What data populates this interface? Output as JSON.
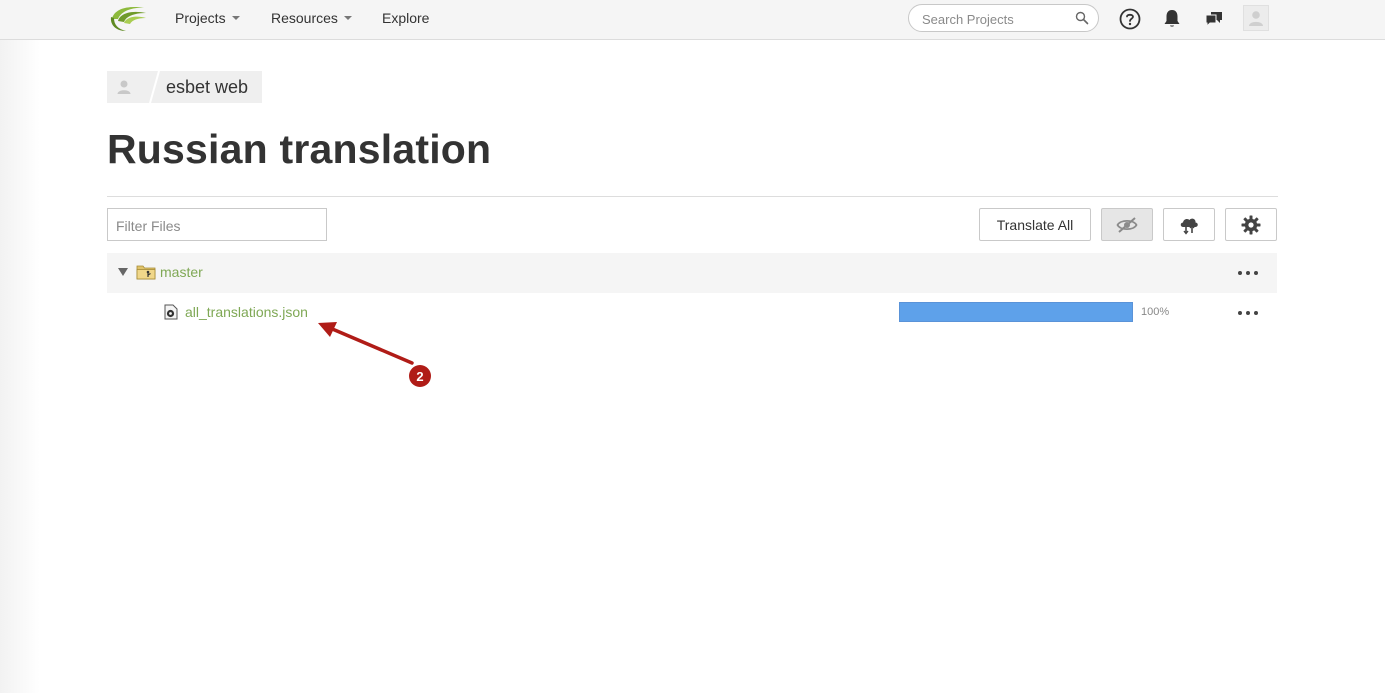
{
  "nav": {
    "items": [
      {
        "label": "Projects",
        "dropdown": true
      },
      {
        "label": "Resources",
        "dropdown": true
      },
      {
        "label": "Explore",
        "dropdown": false
      }
    ],
    "search_placeholder": "Search Projects",
    "icons": [
      "help-icon",
      "bell-icon",
      "chat-icon",
      "avatar"
    ]
  },
  "breadcrumb": {
    "project": "esbet web"
  },
  "page": {
    "title": "Russian translation"
  },
  "toolbar": {
    "filter_placeholder": "Filter Files",
    "translate_all_label": "Translate All",
    "icons": [
      "hide-icon",
      "cloud-sync-icon",
      "gear-icon"
    ]
  },
  "files": {
    "branch": {
      "name": "master"
    },
    "items": [
      {
        "name": "all_translations.json",
        "progress": 1.0,
        "progress_label": "100%"
      }
    ]
  },
  "annotation": {
    "number": "2"
  },
  "colors": {
    "link_green": "#7fa855",
    "progress_blue": "#5ea1ea",
    "annotation_red": "#b01c17"
  }
}
